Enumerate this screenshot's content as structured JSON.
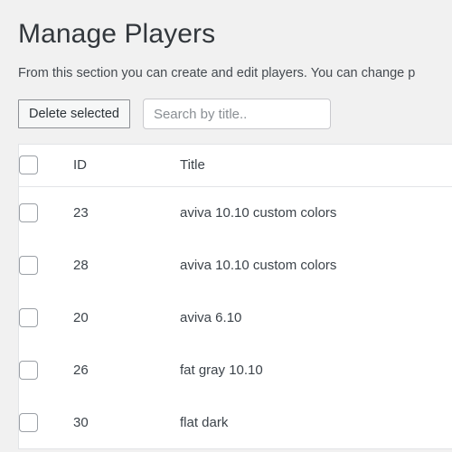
{
  "page": {
    "title": "Manage Players",
    "description": "From this section you can create and edit players. You can change p"
  },
  "toolbar": {
    "delete_button_label": "Delete selected",
    "search_placeholder": "Search by title..",
    "search_value": ""
  },
  "table": {
    "columns": {
      "select_all": "",
      "id": "ID",
      "title": "Title"
    },
    "rows": [
      {
        "id": "23",
        "title": "aviva 10.10 custom colors",
        "checked": false
      },
      {
        "id": "28",
        "title": "aviva 10.10 custom colors",
        "checked": false
      },
      {
        "id": "20",
        "title": "aviva 6.10",
        "checked": false
      },
      {
        "id": "26",
        "title": "fat gray 10.10",
        "checked": false
      },
      {
        "id": "30",
        "title": "flat dark",
        "checked": false
      }
    ]
  },
  "colors": {
    "page_background": "#f1f1f1",
    "surface": "#ffffff",
    "border": "#e2e4e7",
    "text_primary": "#3c434a",
    "text_heading": "#32373c",
    "text_muted": "#50575e",
    "button_border": "#8c8f94",
    "button_face": "#f6f7f7",
    "input_border": "#c9c9cd",
    "placeholder": "#8a8f94"
  }
}
